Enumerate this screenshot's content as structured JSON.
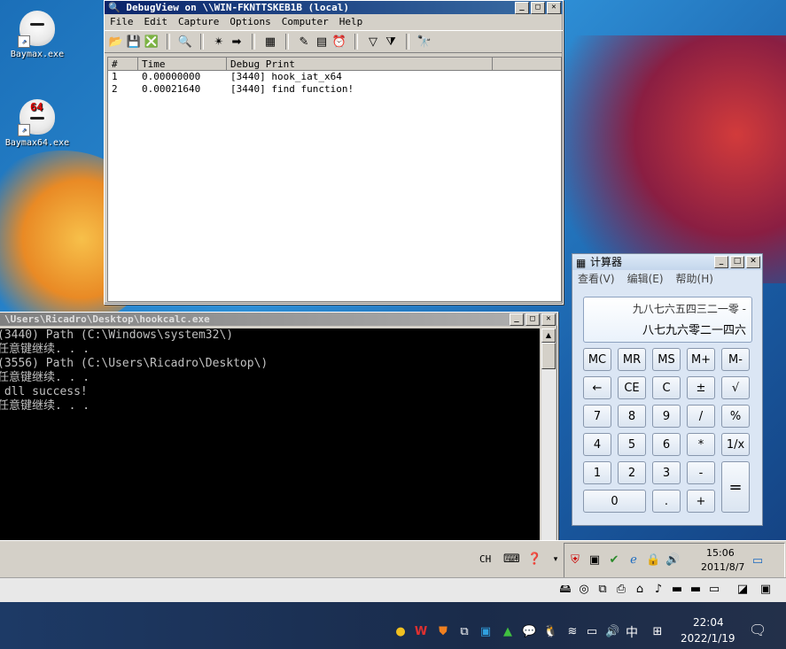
{
  "desktop": {
    "icons": [
      {
        "label": "Baymax.exe",
        "icon": "baymax-app-icon"
      },
      {
        "label": "Baymax64.exe",
        "icon": "baymax64-app-icon",
        "badge": "64"
      }
    ]
  },
  "debugview": {
    "title": "DebugView on \\\\WIN-FKNTTSKEB1B (local)",
    "menu": [
      "File",
      "Edit",
      "Capture",
      "Options",
      "Computer",
      "Help"
    ],
    "columns": [
      "#",
      "Time",
      "Debug Print"
    ],
    "rows": [
      {
        "num": "1",
        "time": "0.00000000",
        "msg": "[3440] hook_iat_x64"
      },
      {
        "num": "2",
        "time": "0.00021640",
        "msg": "[3440] find function!"
      }
    ]
  },
  "console": {
    "title": "\\Users\\Ricadro\\Desktop\\hookcalc.exe",
    "lines": [
      "(3440) Path (C:\\Windows\\system32\\)",
      "任意键继续. . .",
      "(3556) Path (C:\\Users\\Ricadro\\Desktop\\)",
      "任意键继续. . .",
      " dll success!",
      "任意键继续. . ."
    ]
  },
  "calculator": {
    "title": "计算器",
    "menu": [
      "查看(V)",
      "编辑(E)",
      "帮助(H)"
    ],
    "display_expression": "九八七六五四三二一零 -",
    "display_value": "八七九六零二一四六",
    "keys": [
      "MC",
      "MR",
      "MS",
      "M+",
      "M-",
      "←",
      "CE",
      "C",
      "±",
      "√",
      "7",
      "8",
      "9",
      "/",
      "%",
      "4",
      "5",
      "6",
      "*",
      "1/x",
      "1",
      "2",
      "3",
      "-",
      "=",
      "0",
      ".",
      "+"
    ]
  },
  "vm_taskbar": {
    "lang": "CH",
    "time": "15:06",
    "date": "2011/8/7"
  },
  "host_taskbar": {
    "ime": "中",
    "time": "22:04",
    "date": "2022/1/19"
  },
  "colors": {
    "titlebar_active": "#0a246a",
    "console_bg": "#000000",
    "desktop_blue": "#1b6fb8"
  }
}
